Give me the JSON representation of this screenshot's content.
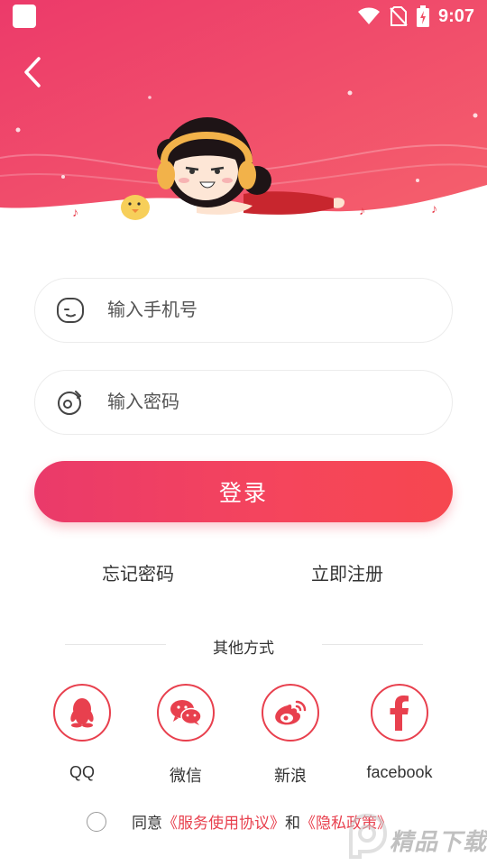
{
  "status_bar": {
    "time": "9:07"
  },
  "login": {
    "phone_placeholder": "输入手机号",
    "password_placeholder": "输入密码",
    "login_label": "登录",
    "forgot_password": "忘记密码",
    "register": "立即注册"
  },
  "other": {
    "title": "其他方式",
    "methods": [
      {
        "label": "QQ",
        "icon": "qq-icon"
      },
      {
        "label": "微信",
        "icon": "wechat-icon"
      },
      {
        "label": "新浪",
        "icon": "weibo-icon"
      },
      {
        "label": "facebook",
        "icon": "facebook-icon"
      }
    ]
  },
  "agreement": {
    "prefix": "同意",
    "service_link": "《服务使用协议》",
    "and": "和",
    "privacy_link": "《隐私政策》"
  },
  "watermark": {
    "text": "精品下载"
  },
  "colors": {
    "accent": "#e8404e",
    "header_gradient_start": "#ec3a6a",
    "header_gradient_end": "#f5616c"
  }
}
